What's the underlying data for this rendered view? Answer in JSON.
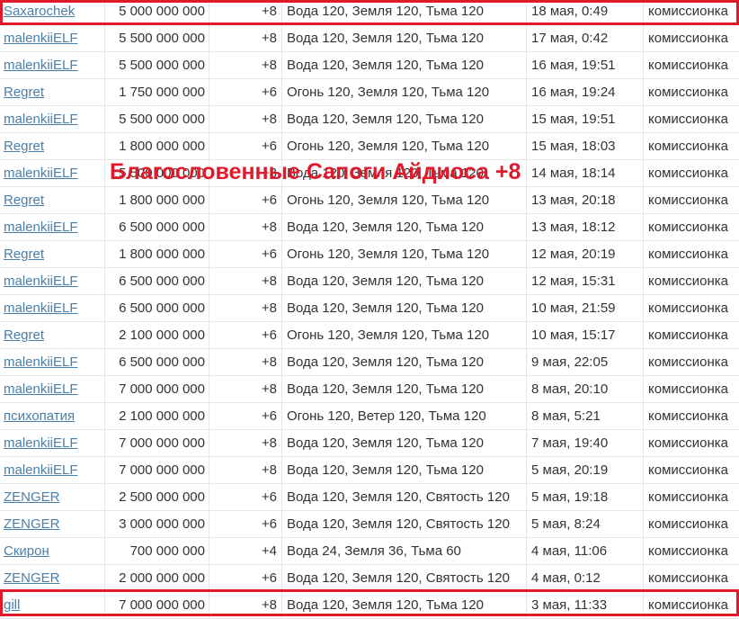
{
  "overlay_caption": "Благословенные Сапоги Айдиоса +8",
  "highlight_color": "#e01a2b",
  "link_color": "#4a7fa8",
  "rows": [
    {
      "seller": "Saxarochek",
      "price": "5 000 000 000",
      "level": "+8",
      "attributes": "Вода 120, Земля 120, Тьма 120",
      "date": "18 мая, 0:49",
      "type": "комиссионка"
    },
    {
      "seller": "malenkiiELF",
      "price": "5 500 000 000",
      "level": "+8",
      "attributes": "Вода 120, Земля 120, Тьма 120",
      "date": "17 мая, 0:42",
      "type": "комиссионка"
    },
    {
      "seller": "malenkiiELF",
      "price": "5 500 000 000",
      "level": "+8",
      "attributes": "Вода 120, Земля 120, Тьма 120",
      "date": "16 мая, 19:51",
      "type": "комиссионка"
    },
    {
      "seller": "Regret",
      "price": "1 750 000 000",
      "level": "+6",
      "attributes": "Огонь 120, Земля 120, Тьма 120",
      "date": "16 мая, 19:24",
      "type": "комиссионка"
    },
    {
      "seller": "malenkiiELF",
      "price": "5 500 000 000",
      "level": "+8",
      "attributes": "Вода 120, Земля 120, Тьма 120",
      "date": "15 мая, 19:51",
      "type": "комиссионка"
    },
    {
      "seller": "Regret",
      "price": "1 800 000 000",
      "level": "+6",
      "attributes": "Огонь 120, Земля 120, Тьма 120",
      "date": "15 мая, 18:03",
      "type": "комиссионка"
    },
    {
      "seller": "malenkiiELF",
      "price": "5 500 000 000",
      "level": "+8",
      "attributes": "Вода 120, Земля 120, Тьма 120",
      "date": "14 мая, 18:14",
      "type": "комиссионка"
    },
    {
      "seller": "Regret",
      "price": "1 800 000 000",
      "level": "+6",
      "attributes": "Огонь 120, Земля 120, Тьма 120",
      "date": "13 мая, 20:18",
      "type": "комиссионка"
    },
    {
      "seller": "malenkiiELF",
      "price": "6 500 000 000",
      "level": "+8",
      "attributes": "Вода 120, Земля 120, Тьма 120",
      "date": "13 мая, 18:12",
      "type": "комиссионка"
    },
    {
      "seller": "Regret",
      "price": "1 800 000 000",
      "level": "+6",
      "attributes": "Огонь 120, Земля 120, Тьма 120",
      "date": "12 мая, 20:19",
      "type": "комиссионка"
    },
    {
      "seller": "malenkiiELF",
      "price": "6 500 000 000",
      "level": "+8",
      "attributes": "Вода 120, Земля 120, Тьма 120",
      "date": "12 мая, 15:31",
      "type": "комиссионка"
    },
    {
      "seller": "malenkiiELF",
      "price": "6 500 000 000",
      "level": "+8",
      "attributes": "Вода 120, Земля 120, Тьма 120",
      "date": "10 мая, 21:59",
      "type": "комиссионка"
    },
    {
      "seller": "Regret",
      "price": "2 100 000 000",
      "level": "+6",
      "attributes": "Огонь 120, Земля 120, Тьма 120",
      "date": "10 мая, 15:17",
      "type": "комиссионка"
    },
    {
      "seller": "malenkiiELF",
      "price": "6 500 000 000",
      "level": "+8",
      "attributes": "Вода 120, Земля 120, Тьма 120",
      "date": "9 мая, 22:05",
      "type": "комиссионка"
    },
    {
      "seller": "malenkiiELF",
      "price": "7 000 000 000",
      "level": "+8",
      "attributes": "Вода 120, Земля 120, Тьма 120",
      "date": "8 мая, 20:10",
      "type": "комиссионка"
    },
    {
      "seller": "психопатия",
      "price": "2 100 000 000",
      "level": "+6",
      "attributes": "Огонь 120, Ветер 120, Тьма 120",
      "date": "8 мая, 5:21",
      "type": "комиссионка"
    },
    {
      "seller": "malenkiiELF",
      "price": "7 000 000 000",
      "level": "+8",
      "attributes": "Вода 120, Земля 120, Тьма 120",
      "date": "7 мая, 19:40",
      "type": "комиссионка"
    },
    {
      "seller": "malenkiiELF",
      "price": "7 000 000 000",
      "level": "+8",
      "attributes": "Вода 120, Земля 120, Тьма 120",
      "date": "5 мая, 20:19",
      "type": "комиссионка"
    },
    {
      "seller": "ZENGER",
      "price": "2 500 000 000",
      "level": "+6",
      "attributes": "Вода 120, Земля 120, Святость 120",
      "date": "5 мая, 19:18",
      "type": "комиссионка"
    },
    {
      "seller": "ZENGER",
      "price": "3 000 000 000",
      "level": "+6",
      "attributes": "Вода 120, Земля 120, Святость 120",
      "date": "5 мая, 8:24",
      "type": "комиссионка"
    },
    {
      "seller": "Скирон",
      "price": "700 000 000",
      "level": "+4",
      "attributes": "Вода 24, Земля 36, Тьма 60",
      "date": "4 мая, 11:06",
      "type": "комиссионка"
    },
    {
      "seller": "ZENGER",
      "price": "2 000 000 000",
      "level": "+6",
      "attributes": "Вода 120, Земля 120, Святость 120",
      "date": "4 мая, 0:12",
      "type": "комиссионка"
    },
    {
      "seller": "gill",
      "price": "7 000 000 000",
      "level": "+8",
      "attributes": "Вода 120, Земля 120, Тьма 120",
      "date": "3 мая, 11:33",
      "type": "комиссионка"
    }
  ]
}
